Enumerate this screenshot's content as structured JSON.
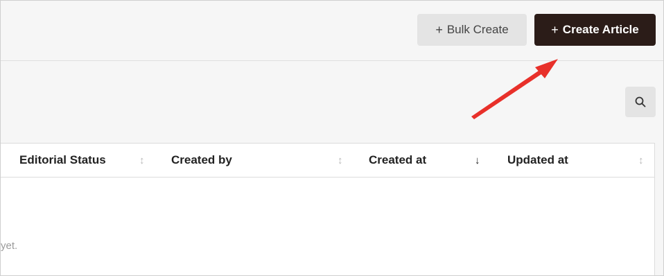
{
  "toolbar": {
    "bulk_create_label": "Bulk Create",
    "create_article_label": "Create Article",
    "plus_glyph": "+"
  },
  "search": {
    "icon": "search-icon"
  },
  "table": {
    "columns": [
      {
        "label": "Editorial Status",
        "sort": "unsorted",
        "sort_glyph": "↕"
      },
      {
        "label": "Created by",
        "sort": "unsorted",
        "sort_glyph": "↕"
      },
      {
        "label": "Created at",
        "sort": "descending",
        "sort_glyph": "↓"
      },
      {
        "label": "Updated at",
        "sort": "unsorted",
        "sort_glyph": "↕"
      }
    ],
    "empty_text_fragment": "yet."
  },
  "annotation": {
    "arrow_color": "#e8302a"
  },
  "colors": {
    "primary_button": "#2b1c18",
    "secondary_button": "#e4e4e4"
  }
}
